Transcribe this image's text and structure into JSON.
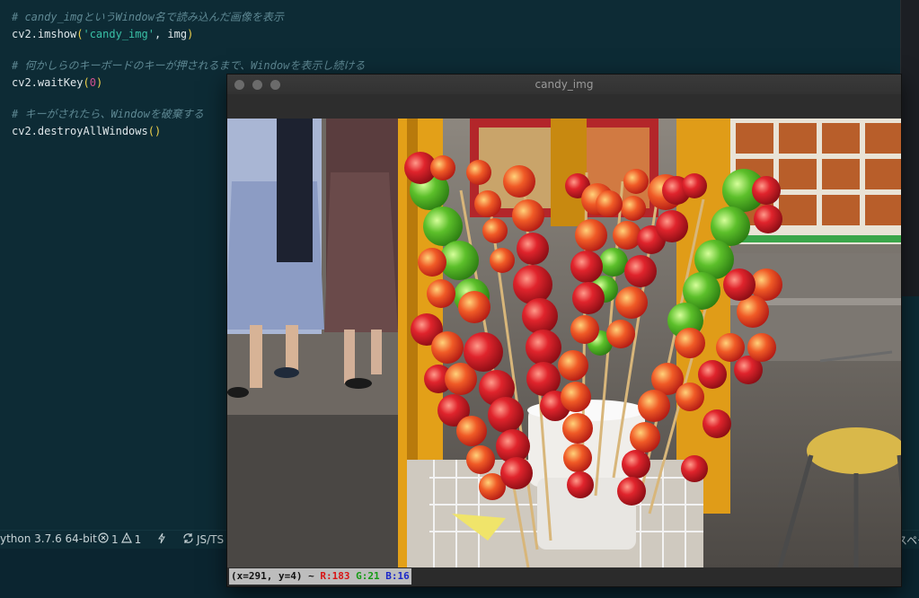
{
  "editor": {
    "lines": [
      {
        "comment": "# candy_imgというWindow名で読み込んだ画像を表示"
      },
      {
        "fn": "cv2.imshow",
        "open": "(",
        "str": "'candy_img'",
        "rest": ", img",
        "close": ")"
      },
      {
        "comment": "# 何かしらのキーボードのキーが押されるまで、Windowを表示し続ける"
      },
      {
        "fn": "cv2.waitKey",
        "open": "(",
        "num": "0",
        "close": ")"
      },
      {
        "comment": "# キーがされたら、Windowを破棄する"
      },
      {
        "fn": "cv2.destroyAllWindows",
        "open": "(",
        "close": ")"
      }
    ]
  },
  "statusbar": {
    "python": "ython 3.7.6 64-bit",
    "errors": "1",
    "warnings": "1",
    "language": "JS/TS",
    "right_text": "スペー"
  },
  "cv_window": {
    "title": "candy_img",
    "pixel_info": {
      "coords": "(x=291, y=4) ~",
      "r": "R:183",
      "g": "G:21",
      "b": "B:16"
    }
  },
  "colors": {
    "editor_bg": "#0d2b35",
    "comment": "#5e8893",
    "string": "#39c0a6",
    "number": "#d04f8f"
  },
  "icons": [
    "error-icon",
    "warning-icon",
    "flash-icon",
    "sync-icon",
    "close-icon",
    "minimize-icon",
    "maximize-icon"
  ]
}
